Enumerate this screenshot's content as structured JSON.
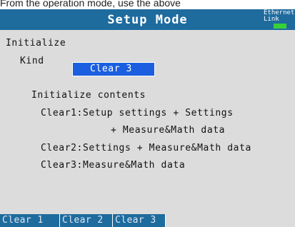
{
  "caption": "From the operation mode, use the above",
  "header": {
    "title": "Setup Mode",
    "indicator_line1": "Ethernet",
    "indicator_line2": "Link",
    "indicator_color": "#39d139"
  },
  "section_title": "Initialize",
  "kind": {
    "label": "Kind",
    "value": "Clear 3"
  },
  "contents": {
    "heading": "Initialize contents",
    "clear1_line1": "Clear1:Setup settings + Settings",
    "clear1_line2": "+ Measure&Math data",
    "clear2": "Clear2:Settings + Measure&Math data",
    "clear3": "Clear3:Measure&Math data"
  },
  "softkeys": [
    "Clear 1",
    "Clear 2",
    "Clear 3"
  ],
  "colors": {
    "accent": "#1e6b9e",
    "selection": "#1b5fe0",
    "background": "#dcdcdc"
  }
}
